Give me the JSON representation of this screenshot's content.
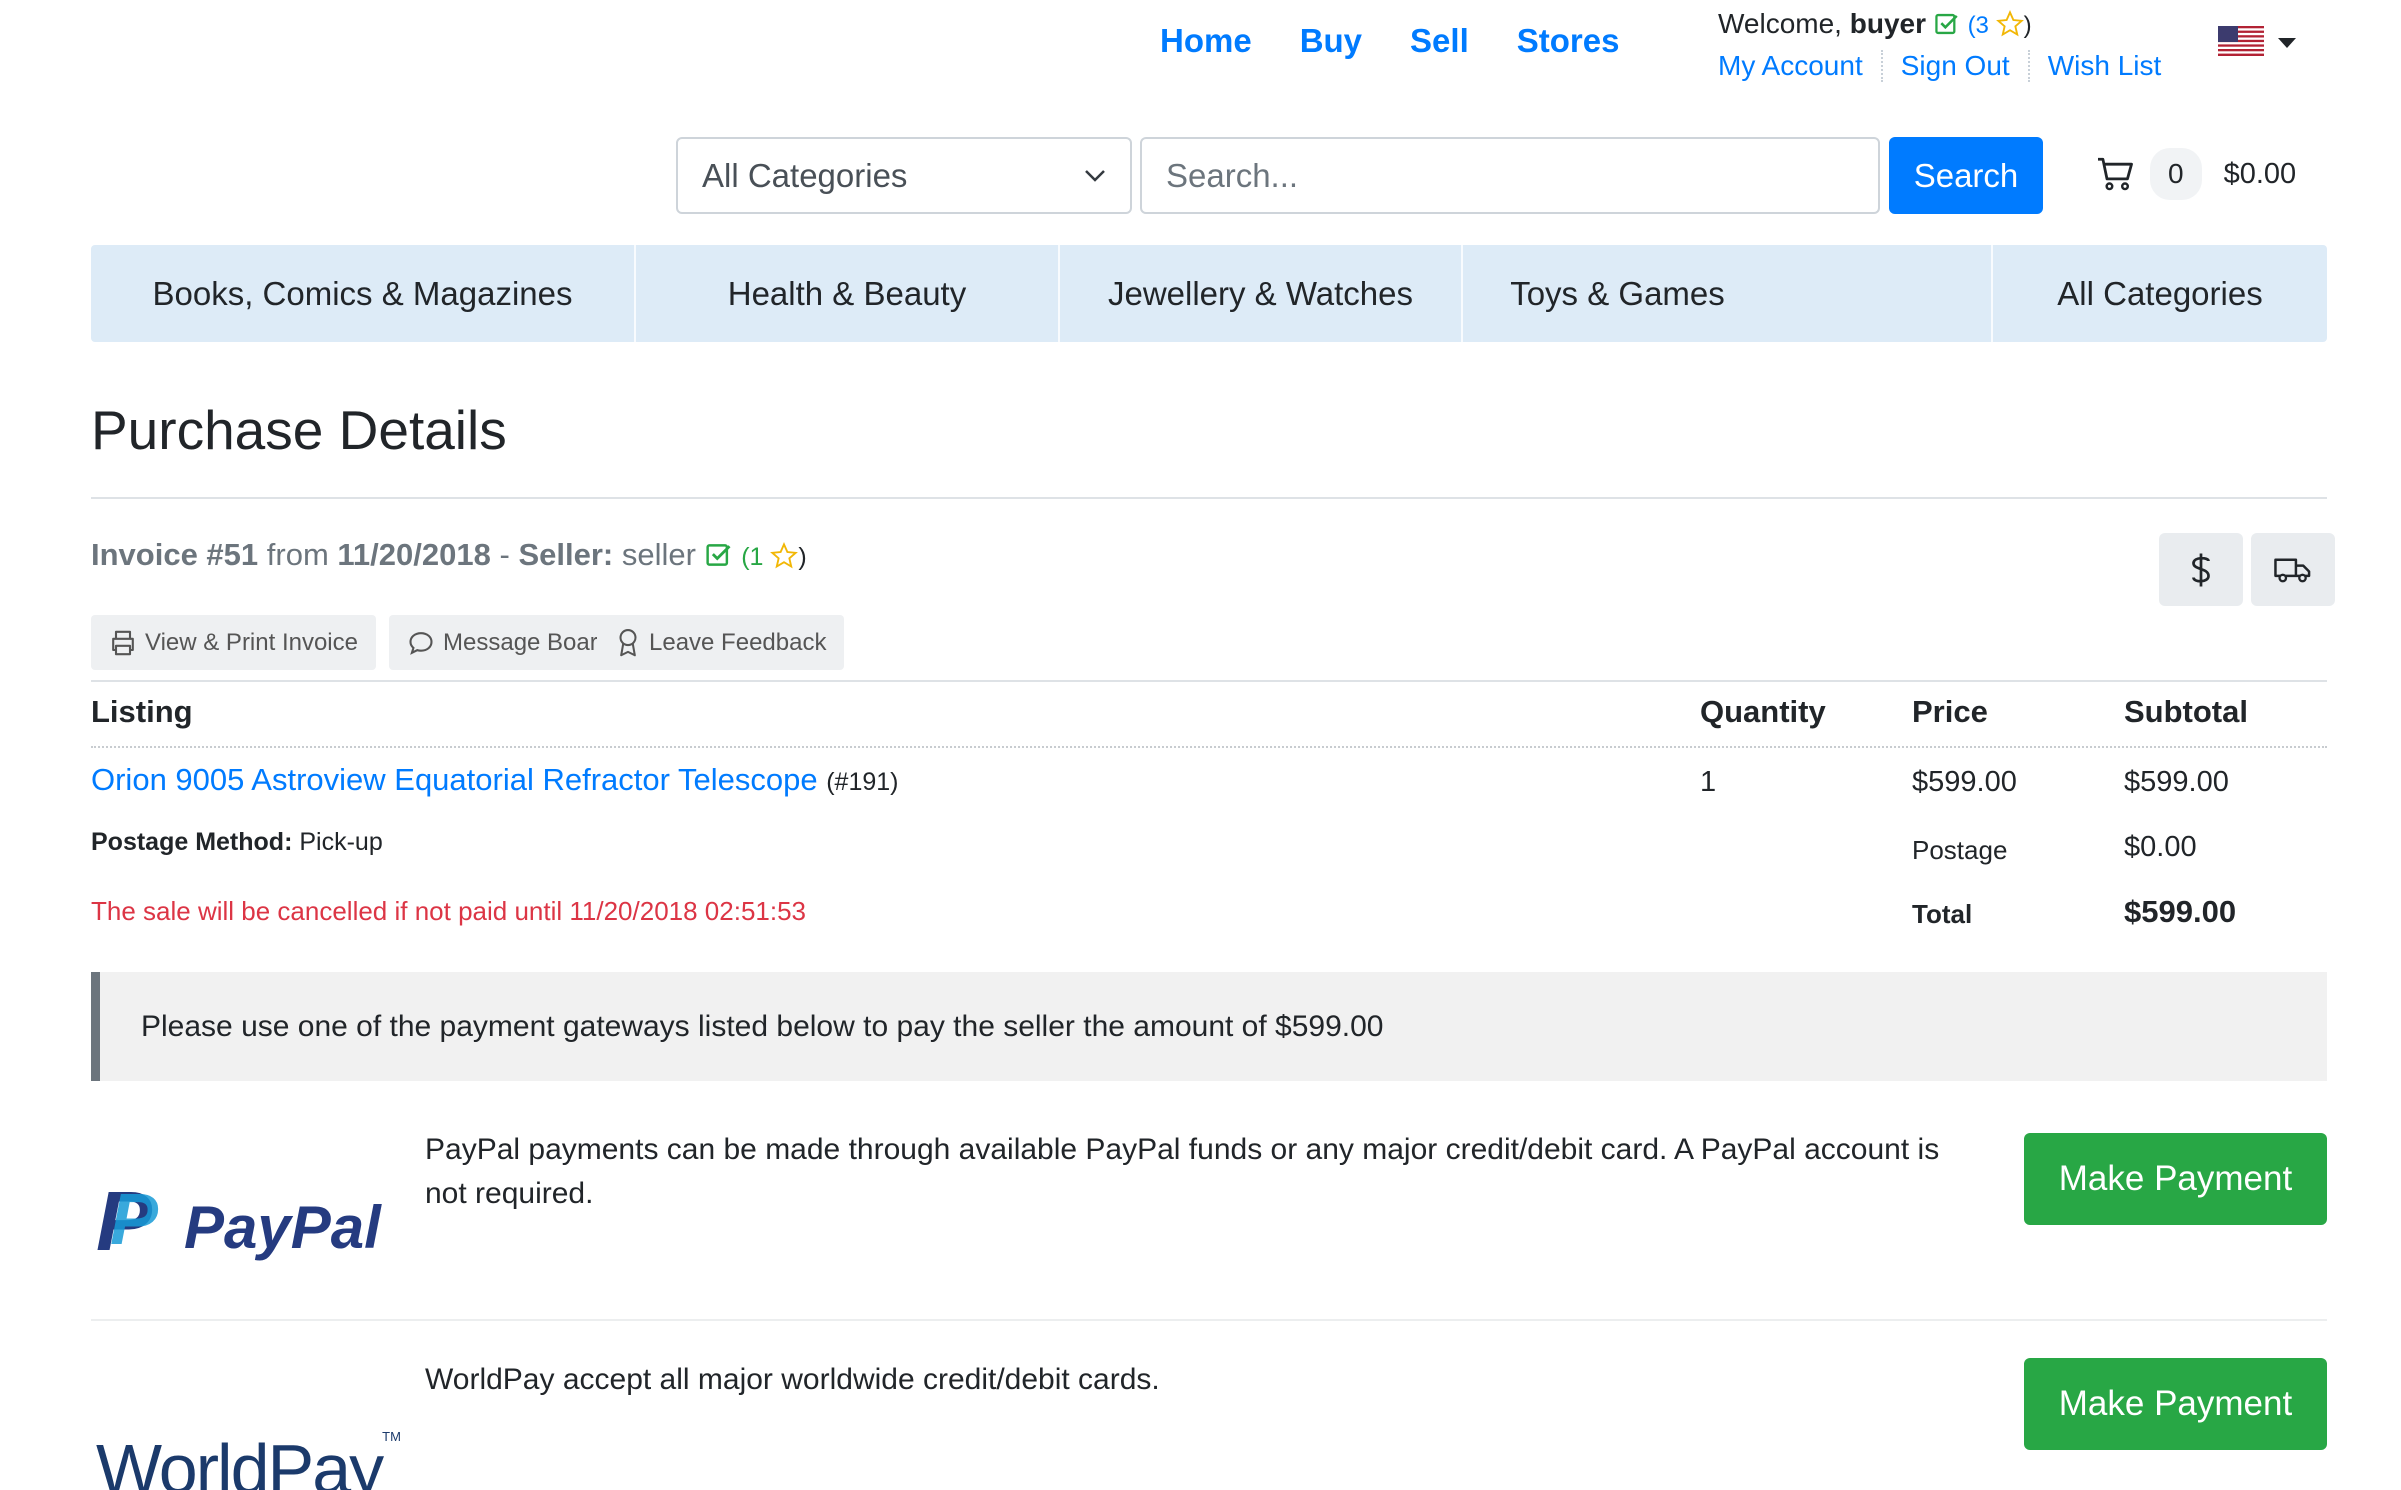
{
  "nav": {
    "home": "Home",
    "buy": "Buy",
    "sell": "Sell",
    "stores": "Stores"
  },
  "user": {
    "welcome": "Welcome,",
    "username": "buyer",
    "rating_open": "(3",
    "rating_close": ")",
    "my_account": "My Account",
    "sign_out": "Sign Out",
    "wish_list": "Wish List"
  },
  "search": {
    "category_selected": "All Categories",
    "placeholder": "Search...",
    "button": "Search"
  },
  "cart": {
    "count": "0",
    "total": "$0.00"
  },
  "categories": [
    "Books, Comics & Magazines",
    "Health & Beauty",
    "Jewellery & Watches",
    "Toys & Games",
    "All Categories"
  ],
  "page_title": "Purchase Details",
  "invoice": {
    "label": "Invoice #51",
    "from_text": "from",
    "date": "11/20/2018",
    "dash": "-",
    "seller_label": "Seller:",
    "seller_name": "seller",
    "seller_rating_open": "(1",
    "seller_rating_close": ")"
  },
  "actions": {
    "print": "View & Print Invoice",
    "message": "Message Board",
    "feedback": "Leave Feedback"
  },
  "table": {
    "headers": {
      "listing": "Listing",
      "quantity": "Quantity",
      "price": "Price",
      "subtotal": "Subtotal"
    },
    "item": {
      "title": "Orion 9005 Astroview Equatorial Refractor Telescope",
      "id": "(#191)",
      "quantity": "1",
      "price": "$599.00",
      "subtotal": "$599.00"
    },
    "postage_method_label": "Postage Method:",
    "postage_method_value": "Pick-up",
    "postage_label": "Postage",
    "postage_value": "$0.00",
    "total_label": "Total",
    "total_value": "$599.00",
    "cancel_notice": "The sale will be cancelled if not paid until 11/20/2018 02:51:53"
  },
  "payment_notice": "Please use one of the payment gateways listed below to pay the seller the amount of $599.00",
  "gateways": [
    {
      "logo_text": "PayPal",
      "description": "PayPal payments can be made through available PayPal funds or any major credit/debit card. A PayPal account is not required.",
      "button": "Make Payment"
    },
    {
      "logo_text": "WorldPay",
      "logo_mark": "TM",
      "description": "WorldPay accept all major worldwide credit/debit cards.",
      "button": "Make Payment"
    }
  ],
  "colors": {
    "link": "#007bff",
    "success": "#28a745",
    "danger": "#dc3545",
    "category_bar": "#ddebf7",
    "paypal_dark": "#253b80",
    "paypal_light": "#179bd7",
    "worldpay": "#1b3a6b"
  }
}
